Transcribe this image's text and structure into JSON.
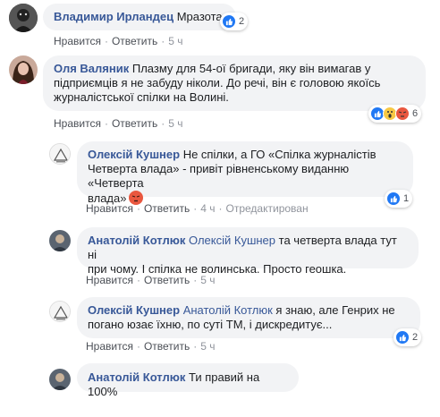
{
  "comments": [
    {
      "author": "Владимир Ирландец",
      "text": "Мразота",
      "reactions": {
        "types": [
          "like"
        ],
        "count": "2"
      },
      "actions": {
        "like": "Нравится",
        "reply": "Ответить",
        "time": "5 ч"
      }
    },
    {
      "author": "Оля Валяник",
      "text_line1": "Плазму для 54-ої бригади, яку він вимагав у",
      "text_line2": "підприємців я не забуду ніколи. До речі, він є головою якоїсь",
      "text_line3": "журналістської спілки на Волині.",
      "reactions": {
        "types": [
          "like",
          "wow",
          "angry"
        ],
        "count": "6"
      },
      "actions": {
        "like": "Нравится",
        "reply": "Ответить",
        "time": "5 ч"
      }
    },
    {
      "author": "Олексій Кушнер",
      "text_line1": "Не спілки, а ГО «Спілка журналістів",
      "text_line2": "Четверта влада» - привіт рівненському виданню «Четверта",
      "text_line3": "влада»",
      "reactions": {
        "types": [
          "like"
        ],
        "count": "1"
      },
      "actions": {
        "like": "Нравится",
        "reply": "Ответить",
        "time": "4 ч",
        "edited": "Отредактирован"
      }
    },
    {
      "author": "Анатолій Котлюк",
      "mention": "Олексій Кушнер",
      "text_line1": "та четверта влада тут ні",
      "text_line2": "при чому. І спілка не волинська. Просто геошка.",
      "actions": {
        "like": "Нравится",
        "reply": "Ответить",
        "time": "5 ч"
      }
    },
    {
      "author": "Олексій Кушнер",
      "mention": "Анатолій Котлюк",
      "text_line1": "я знаю, але Генрих не",
      "text_line2": "погано юзає їхню, по суті ТМ, і дискредитує...",
      "reactions": {
        "types": [
          "like"
        ],
        "count": "2"
      },
      "actions": {
        "like": "Нравится",
        "reply": "Ответить",
        "time": "5 ч"
      }
    },
    {
      "author": "Анатолій Котлюк",
      "text": "Ти правий на 100%"
    }
  ],
  "colors": {
    "link": "#385898",
    "bubble": "#f2f3f5",
    "like": "#2078f4",
    "angry": "#e9573f",
    "wow": "#f7c945"
  }
}
